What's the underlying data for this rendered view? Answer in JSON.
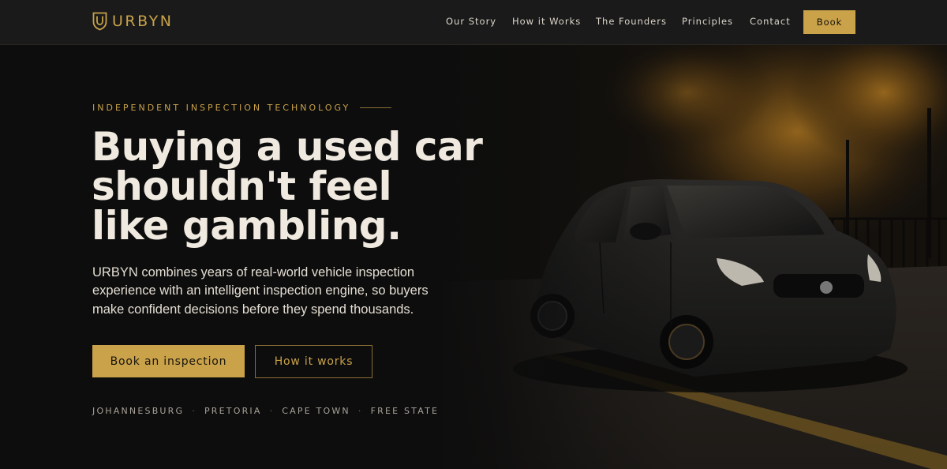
{
  "brand": {
    "name": "URBYN",
    "accent": "#c9a24a",
    "logo_icon": "shield-icon"
  },
  "nav": {
    "links": [
      "Our Story",
      "How it Works",
      "The Founders",
      "Principles",
      "Contact"
    ],
    "book_label": "Book"
  },
  "hero": {
    "eyebrow": "INDEPENDENT INSPECTION TECHNOLOGY",
    "headline": [
      "Buying a used car",
      "shouldn't feel",
      "like gambling."
    ],
    "intro": "URBYN combines years of real-world vehicle inspection experience with an intelligent inspection engine, so buyers make confident decisions before they spend thousands.",
    "primary_cta": "Book an inspection",
    "secondary_cta": "How it works",
    "cities": [
      "JOHANNESBURG",
      "PRETORIA",
      "CAPE TOWN",
      "FREE STATE"
    ],
    "city_separator": "·"
  },
  "colors": {
    "background": "#0d0d0d",
    "header": "#1a1a1a",
    "text": "#efe9df",
    "muted": "#a8a299"
  }
}
